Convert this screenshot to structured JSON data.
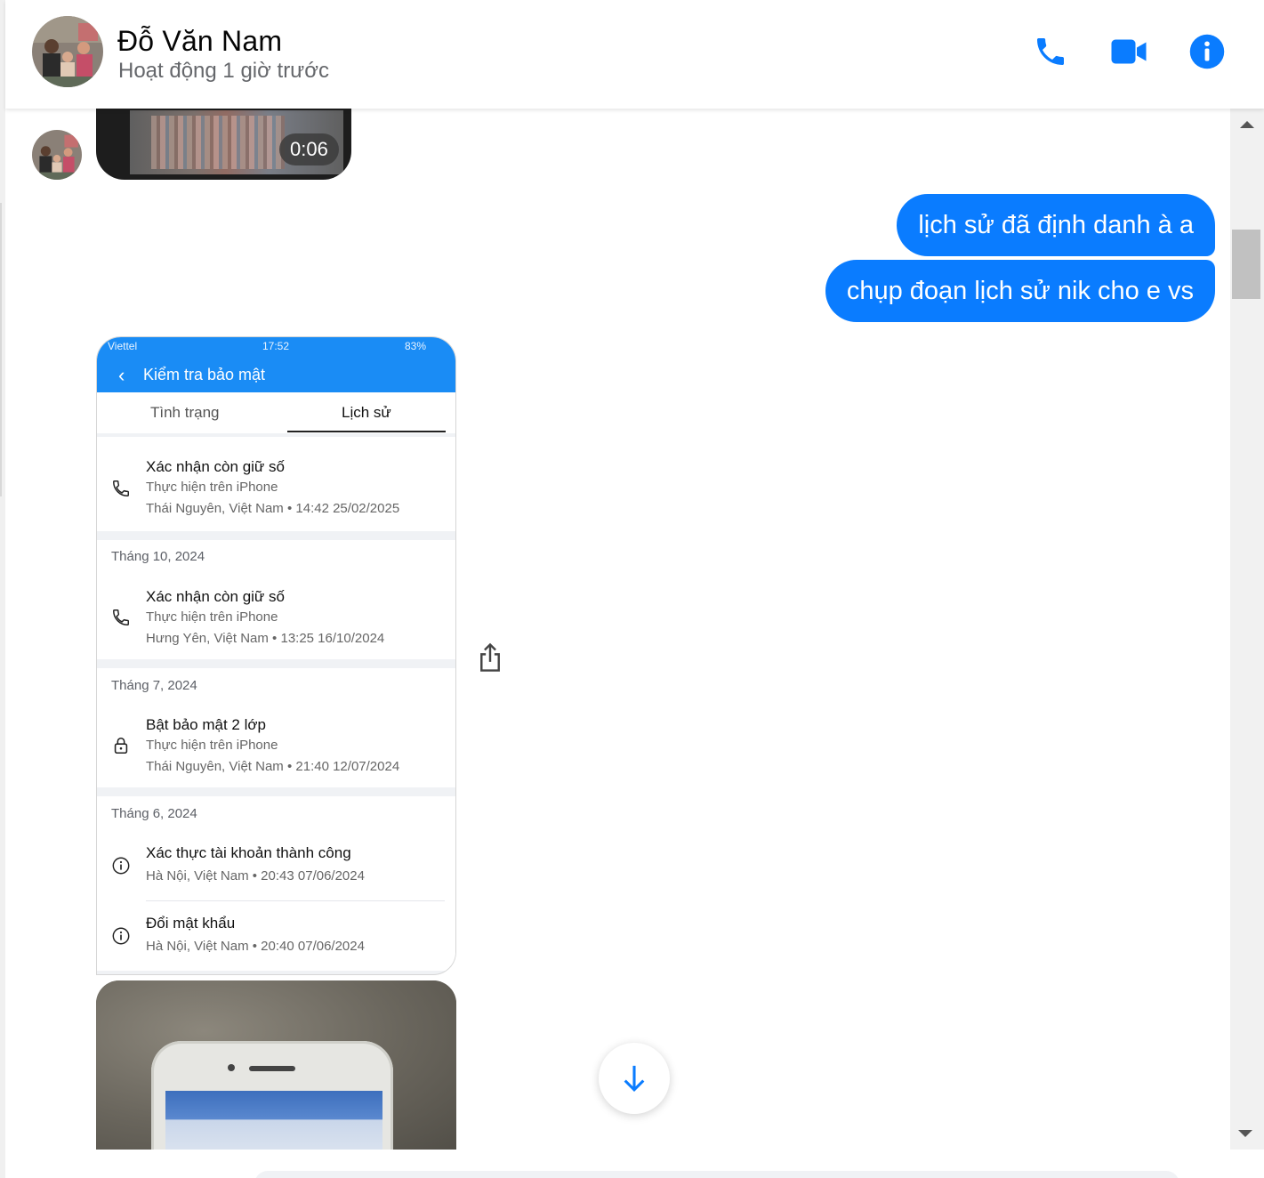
{
  "header": {
    "name": "Đỗ Văn Nam",
    "status": "Hoạt động 1 giờ trước",
    "accent": "#0a7cff"
  },
  "video": {
    "duration": "0:06"
  },
  "messages": {
    "sent": [
      "lịch sử đã định danh à a",
      "chụp đoạn lịch sử nik cho e vs"
    ]
  },
  "screenshot": {
    "statusbar": {
      "carrier": "Viettel",
      "time": "17:52",
      "battery": "83%"
    },
    "title": "Kiểm tra bảo mật",
    "tabs": [
      "Tình trạng",
      "Lịch sử"
    ],
    "sections": [
      {
        "month": "",
        "entries": [
          {
            "title": "Xác nhận còn giữ số",
            "device": "Thực hiện trên iPhone",
            "place": "Thái Nguyên, Việt Nam • 14:42 25/02/2025",
            "icon": "phone-icon"
          }
        ]
      },
      {
        "month": "Tháng 10, 2024",
        "entries": [
          {
            "title": "Xác nhận còn giữ số",
            "device": "Thực hiện trên iPhone",
            "place": "Hưng Yên, Việt Nam • 13:25 16/10/2024",
            "icon": "phone-icon"
          }
        ]
      },
      {
        "month": "Tháng 7, 2024",
        "entries": [
          {
            "title": "Bật bảo mật 2 lớp",
            "device": "Thực hiện trên iPhone",
            "place": "Thái Nguyên, Việt Nam • 21:40 12/07/2024",
            "icon": "lock-icon"
          }
        ]
      },
      {
        "month": "Tháng 6, 2024",
        "entries": [
          {
            "title": "Xác thực tài khoản thành công",
            "place": "Hà Nội, Việt Nam • 20:43 07/06/2024",
            "icon": "info-icon"
          },
          {
            "title": "Đổi mật khẩu",
            "place": "Hà Nội, Việt Nam • 20:40 07/06/2024",
            "icon": "info-icon"
          }
        ]
      }
    ]
  }
}
